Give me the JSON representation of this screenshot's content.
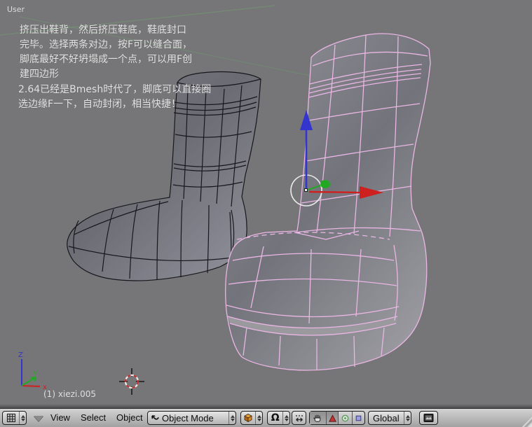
{
  "viewport": {
    "view_label": "User",
    "note1": "挤压出鞋背，然后挤压鞋底，鞋底封口\n完毕。选择两条对边，按F可以缝合面，\n脚底最好不好坍塌成一个点，可以用F创\n建四边形",
    "note2": "2.64已经是Bmesh时代了，脚底可以直接圈\n选边缘F一下，自动封闭，相当快捷！",
    "object_info": "(1) xiezi.005",
    "axis": {
      "x": "x",
      "y": "Y",
      "z": "Z"
    }
  },
  "toolbar": {
    "menus": [
      "View",
      "Select",
      "Object"
    ],
    "mode_label": "Object Mode",
    "orientation_label": "Global",
    "icons": {
      "editor_type": "grid-icon",
      "collapse": "chevron-down-icon",
      "mode": "object-mode-arrow-icon",
      "shading": "solid-shading-cube-icon",
      "pivot": "pivot-omega-icon",
      "pivot_glyph": "Ω",
      "centers": "manipulate-centers-icon",
      "hand": "manipulator-hand-icon",
      "translate": "translate-arrow-icon",
      "rotate": "rotate-circle-icon",
      "scale": "scale-square-icon",
      "render": "render-preview-icon"
    }
  },
  "colors": {
    "viewport_bg": "#767678",
    "wire_unselected": "#17171c",
    "wire_selected": "#eab6e4",
    "axis_x": "#cf2020",
    "axis_y": "#23a823",
    "axis_z": "#3434cf",
    "grid_green": "#6f9f6f",
    "cursor_red": "#c03030",
    "shading_icon_orange": "#d8891f"
  }
}
